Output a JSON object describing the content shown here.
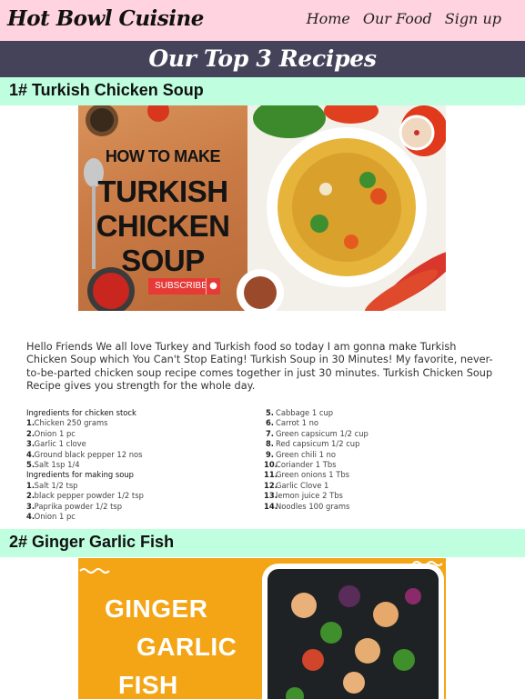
{
  "header": {
    "brand": "Hot Bowl Cuisine",
    "nav": [
      "Home",
      "Our Food",
      "Sign up"
    ]
  },
  "hero": {
    "title": "Our Top 3 Recipes"
  },
  "recipe1": {
    "heading": "1# Turkish Chicken Soup",
    "image": {
      "howto": "HOW TO MAKE",
      "lines": [
        "TURKISH",
        "CHICKEN",
        "SOUP"
      ],
      "subscribe": "SUBSCRIBE"
    },
    "intro": "Hello Friends We all love Turkey and Turkish food so today I am gonna make Turkish Chicken Soup which You Can't Stop Eating! Turkish Soup in 30 Minutes! My favorite, never-to-be-parted chicken soup recipe comes together in just 30 minutes. Turkish Chicken Soup Recipe gives you strength for the whole day.",
    "stock_title": "Ingredients for chicken stock",
    "stock": [
      "Chicken 250 grams",
      "Onion 1 pc",
      "Garlic 1 clove",
      "Ground black pepper 12 nos",
      "Salt 1sp 1/4"
    ],
    "soup_title": "Ingredients for making soup",
    "soup": [
      "Salt 1/2 tsp",
      "black pepper powder 1/2 tsp",
      "Paprika powder 1/2 tsp",
      "Onion 1 pc"
    ],
    "soup2": [
      "Cabbage 1 cup",
      "Carrot 1 no",
      "Green capsicum 1/2 cup",
      "Red capsicum 1/2 cup",
      "Green chili 1 no",
      "Coriander 1 Tbs",
      "Green onions 1 Tbs",
      "Garlic Clove 1",
      "lemon juice 2 Tbs",
      "Noodles 100 grams"
    ]
  },
  "recipe2": {
    "heading": "2# Ginger Garlic Fish",
    "image": {
      "lines": [
        "GINGER",
        "GARLIC",
        "FISH"
      ]
    }
  }
}
